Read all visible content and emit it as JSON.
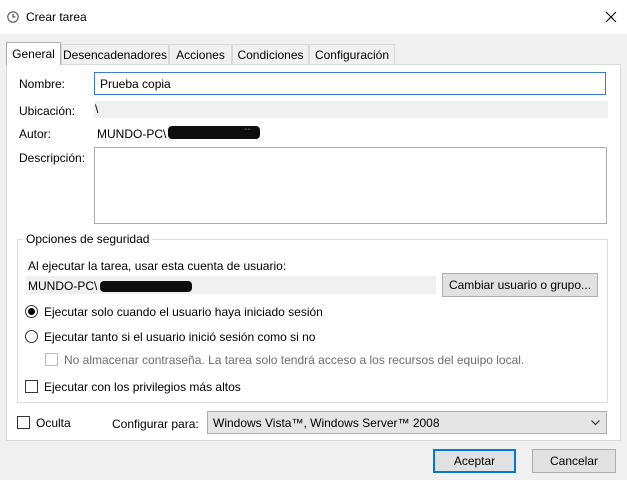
{
  "window": {
    "title": "Crear tarea",
    "close_glyph": "✕"
  },
  "tabs": [
    {
      "label": "General",
      "active": true
    },
    {
      "label": "Desencadenadores"
    },
    {
      "label": "Acciones"
    },
    {
      "label": "Condiciones"
    },
    {
      "label": "Configuración"
    }
  ],
  "general": {
    "name_label": "Nombre:",
    "name_value": "Prueba copia",
    "location_label": "Ubicación:",
    "location_value": "\\",
    "author_label": "Autor:",
    "author_prefix": "MUNDO-PC\\",
    "author_suffix": "--",
    "description_label": "Descripción:",
    "description_value": ""
  },
  "security": {
    "group_title": "Opciones de seguridad",
    "run_as_label": "Al ejecutar la tarea, usar esta cuenta de usuario:",
    "user_prefix": "MUNDO-PC\\",
    "change_user_button": "Cambiar usuario o grupo...",
    "option_logged_on": "Ejecutar solo cuando el usuario haya iniciado sesión",
    "option_logged_on_or_not": "Ejecutar tanto si el usuario inició sesión como si no",
    "no_store_password": "No almacenar contraseña. La tarea solo tendrá acceso a los recursos del equipo local.",
    "highest_privileges": "Ejecutar con los privilegios más altos",
    "selected_option": "logged_on"
  },
  "footer": {
    "hidden_label": "Oculta",
    "configure_label": "Configurar para:",
    "configure_value": "Windows Vista™, Windows Server™ 2008",
    "ok_button": "Aceptar",
    "cancel_button": "Cancelar"
  },
  "icons": {
    "window": "clock-icon",
    "close": "close-icon",
    "dropdown": "chevron-down-icon"
  },
  "colors": {
    "accent": "#0078d7",
    "focus_border": "#3a7bd5",
    "dialog_bg": "#f0f0f0"
  }
}
